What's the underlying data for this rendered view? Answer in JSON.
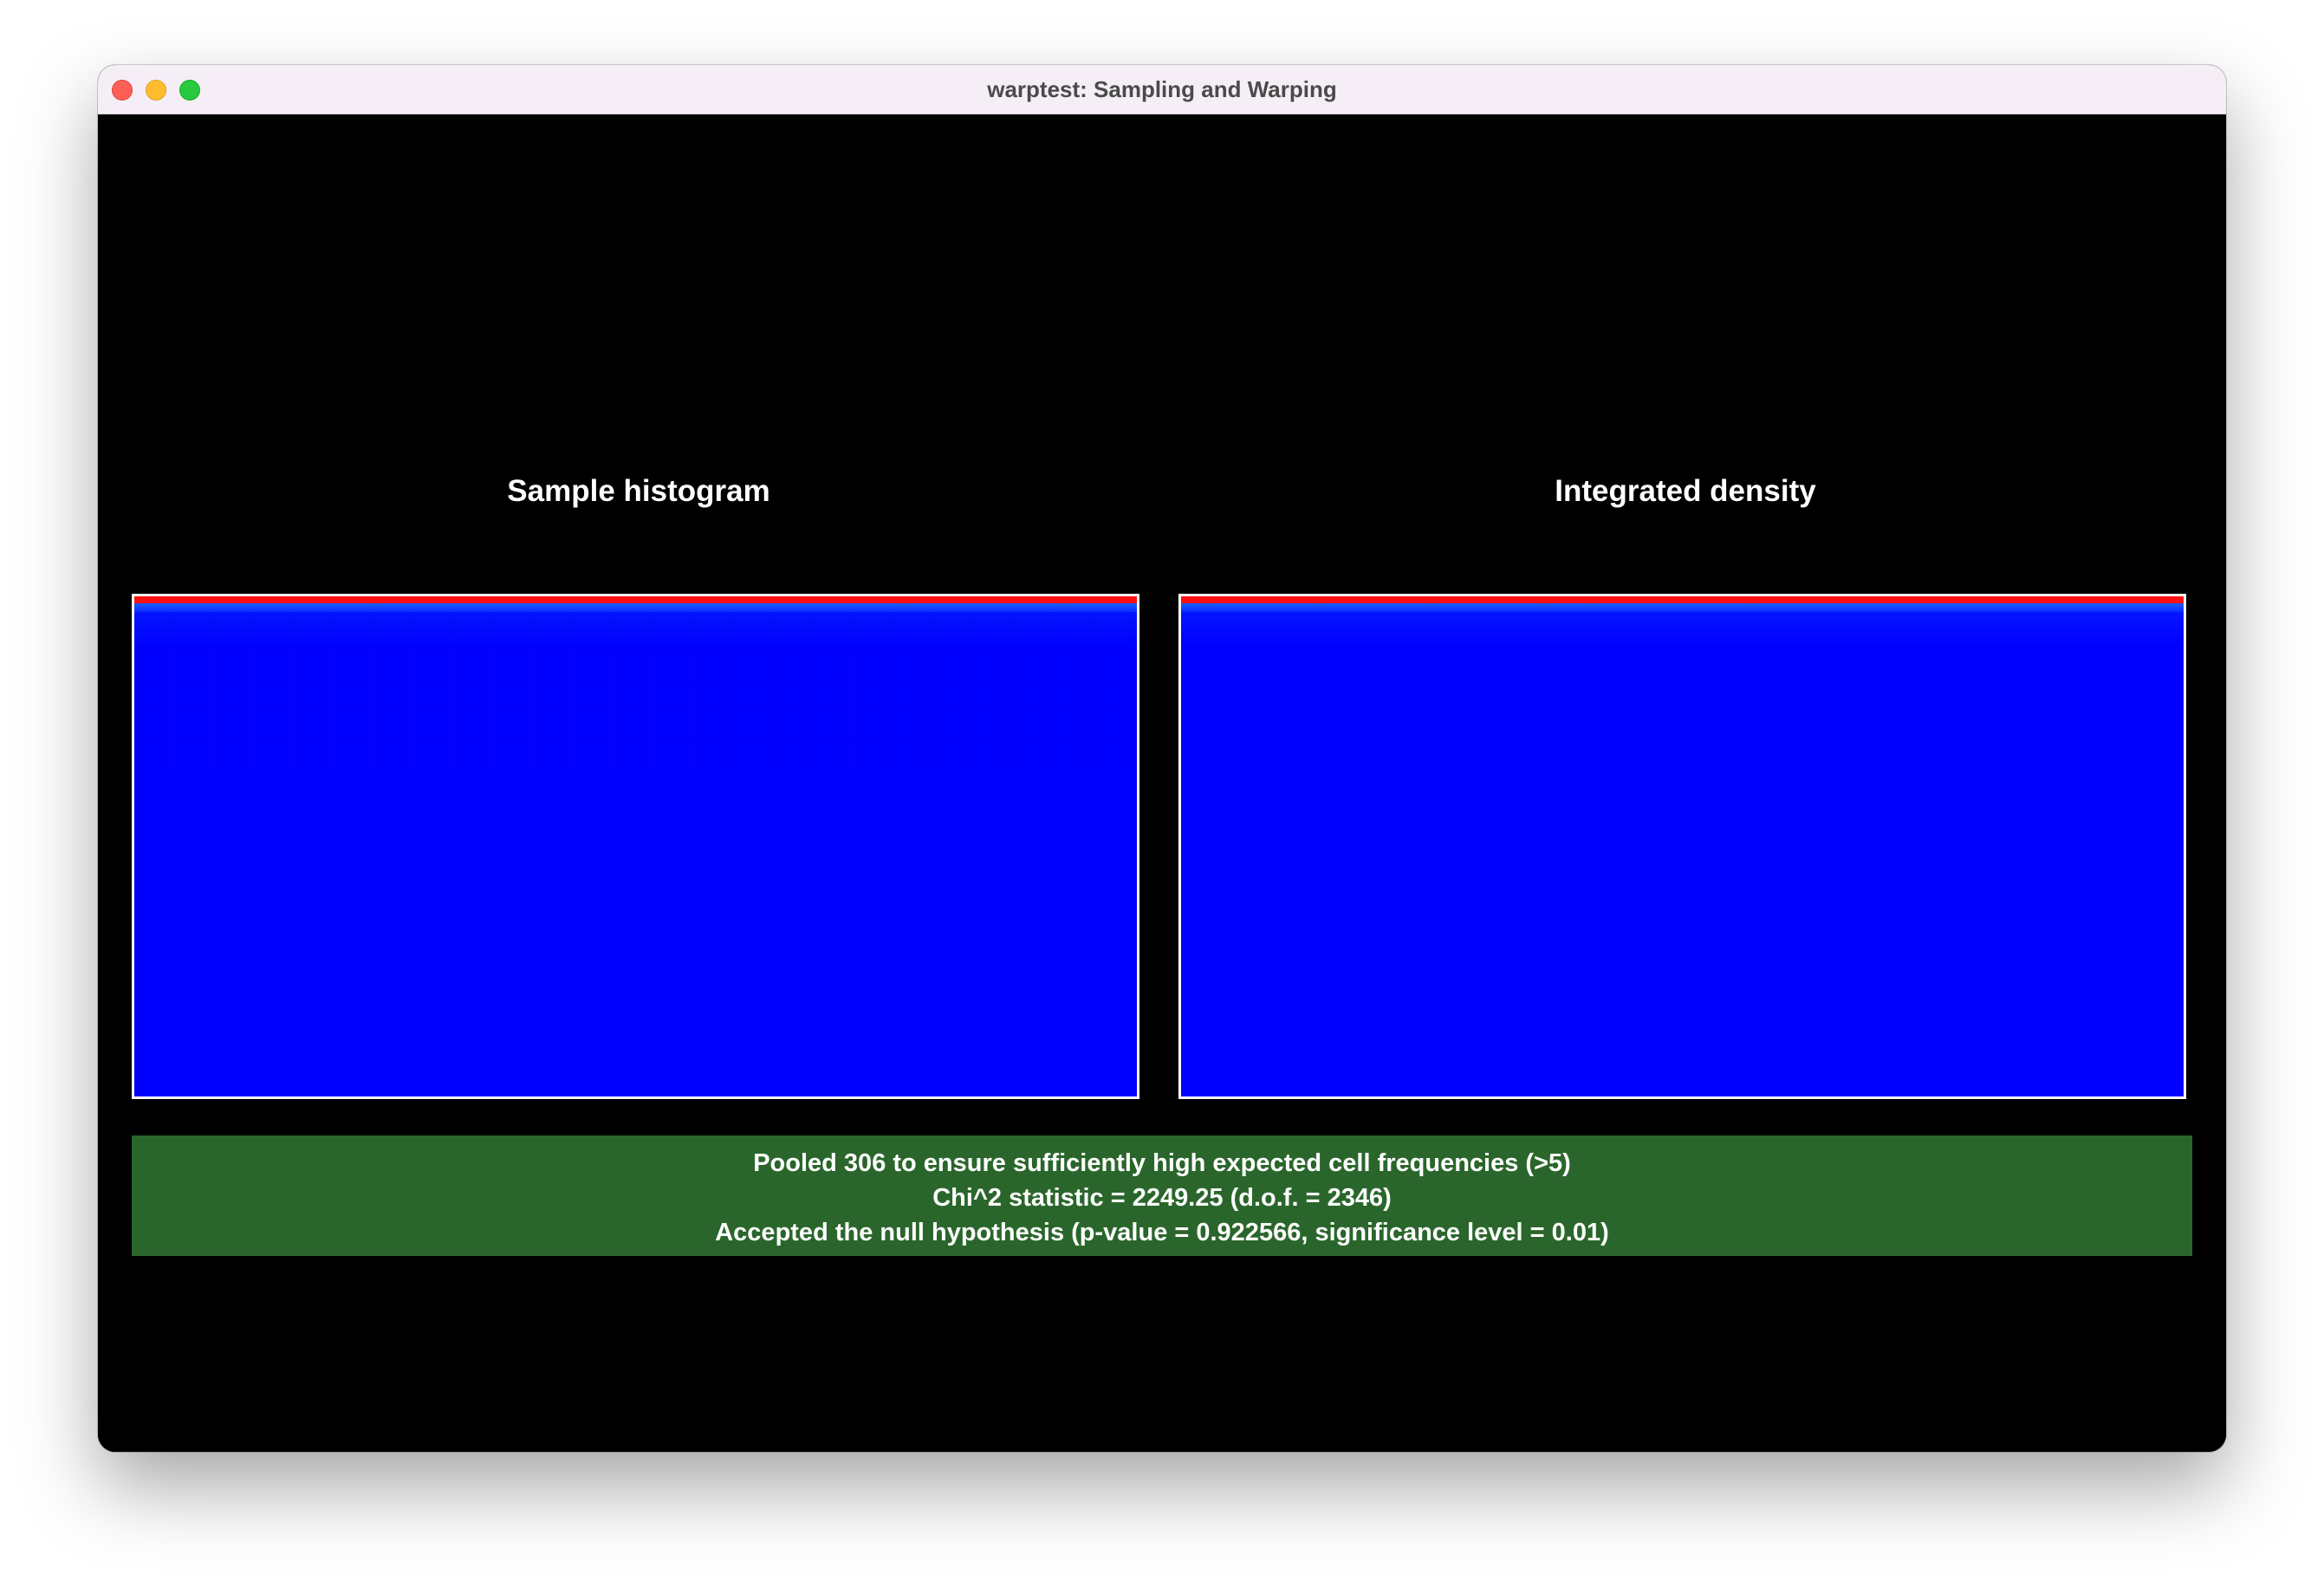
{
  "window": {
    "title": "warptest: Sampling and Warping"
  },
  "panels": {
    "left_title": "Sample histogram",
    "right_title": "Integrated density"
  },
  "status": {
    "line1": "Pooled 306 to ensure sufficiently high expected cell frequencies (>5)",
    "line2": "Chi^2 statistic = 2249.25 (d.o.f. = 2346)",
    "line3": "Accepted the null hypothesis (p-value = 0.922566, significance level = 0.01)",
    "background_color": "#2a662b"
  },
  "colors": {
    "plot_fill": "#0000ff",
    "plot_top_band": "#ff1010",
    "plot_border": "#ffffff",
    "content_background": "#000000"
  }
}
